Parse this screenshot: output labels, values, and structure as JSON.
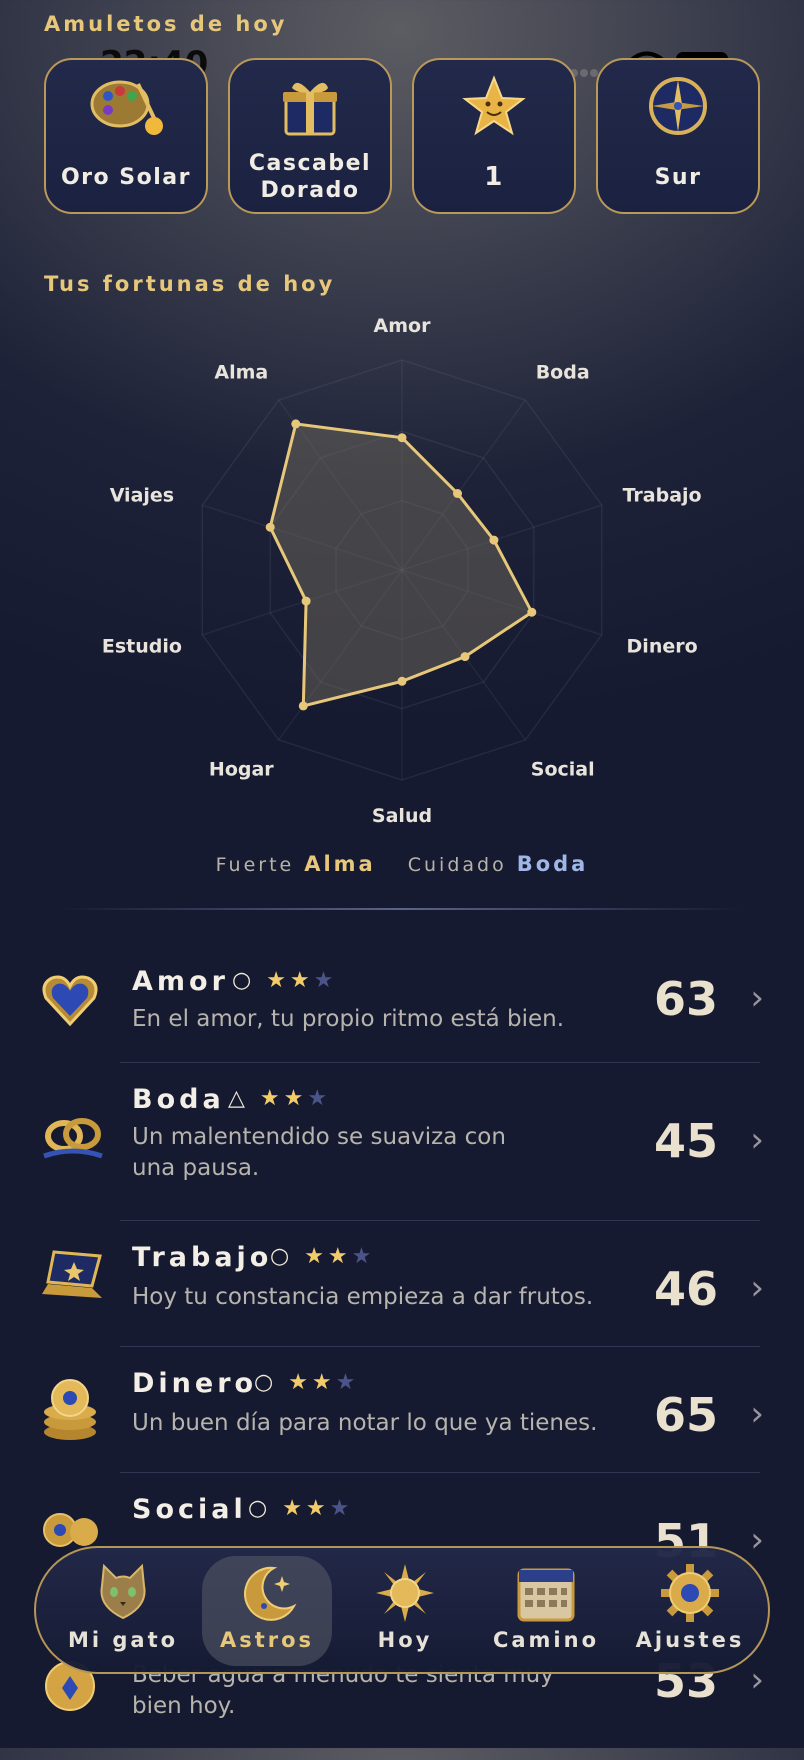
{
  "status_bar": {
    "time": "22:40"
  },
  "amulets": {
    "title": "Amuletos de hoy",
    "items": [
      {
        "label": "Oro Solar",
        "icon": "palette-icon"
      },
      {
        "label": "Cascabel Dorado",
        "label_line1": "Cascabel",
        "label_line2": "Dorado",
        "icon": "gift-box-icon"
      },
      {
        "label": "1",
        "icon": "star-icon"
      },
      {
        "label": "Sur",
        "icon": "compass-icon"
      }
    ]
  },
  "fortunes": {
    "title": "Tus fortunas de hoy",
    "axes": [
      "Amor",
      "Boda",
      "Trabajo",
      "Dinero",
      "Social",
      "Salud",
      "Hogar",
      "Estudio",
      "Viajes",
      "Alma"
    ],
    "legend": {
      "strong_label": "Fuerte",
      "strong_value": "Alma",
      "careful_label": "Cuidado",
      "careful_value": "Boda"
    }
  },
  "chart_data": {
    "type": "radar",
    "categories": [
      "Amor",
      "Boda",
      "Trabajo",
      "Dinero",
      "Social",
      "Salud",
      "Hogar",
      "Estudio",
      "Viajes",
      "Alma"
    ],
    "values": [
      63,
      45,
      46,
      65,
      51,
      53,
      80,
      48,
      66,
      86
    ],
    "range": [
      0,
      100
    ],
    "color": "#e7c77a"
  },
  "list": [
    {
      "name": "Amor",
      "mark": "○",
      "stars": 2,
      "max_stars": 3,
      "desc": "En el amor, tu propio ritmo está bien.",
      "score": "63",
      "icon": "heart-amulet-icon"
    },
    {
      "name": "Boda",
      "mark": "△",
      "stars": 2,
      "max_stars": 3,
      "desc": "Un malentendido se suaviza con una pausa.",
      "desc_l1": "Un malentendido se suaviza con",
      "desc_l2": "una pausa.",
      "score": "45",
      "icon": "rings-icon"
    },
    {
      "name": "Trabajo",
      "mark": "○",
      "stars": 2,
      "max_stars": 3,
      "desc": "Hoy tu constancia empieza a dar frutos.",
      "score": "46",
      "icon": "laptop-icon"
    },
    {
      "name": "Dinero",
      "mark": "○",
      "stars": 2,
      "max_stars": 3,
      "desc": "Un buen día para notar lo que ya tienes.",
      "score": "65",
      "icon": "coins-icon"
    },
    {
      "name": "Social",
      "mark": "○",
      "stars": 2,
      "max_stars": 3,
      "desc": "",
      "score": "51",
      "icon": "social-icon"
    },
    {
      "name": "",
      "mark": "",
      "stars": 0,
      "max_stars": 0,
      "desc": "Beber agua a menudo te sienta muy bien hoy.",
      "desc_l1": "Beber agua a menudo te sienta muy",
      "desc_l2": "bien hoy.",
      "score": "53",
      "icon": "health-icon"
    }
  ],
  "tabs": [
    {
      "label": "Mi gato",
      "icon": "cat-icon",
      "active": false
    },
    {
      "label": "Astros",
      "icon": "moon-icon",
      "active": true
    },
    {
      "label": "Hoy",
      "icon": "sun-icon",
      "active": false
    },
    {
      "label": "Camino",
      "icon": "calendar-icon",
      "active": false
    },
    {
      "label": "Ajustes",
      "icon": "gear-icon",
      "active": false
    }
  ],
  "colors": {
    "gold": "#e7c77a",
    "careful": "#9fb6e6",
    "star_off": "#4b5488"
  }
}
